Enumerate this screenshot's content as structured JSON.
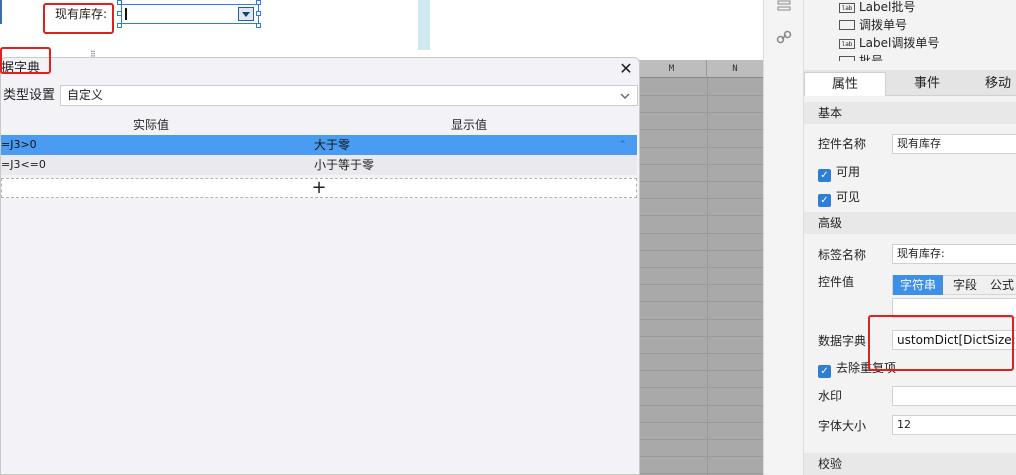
{
  "canvas": {
    "field_label": "现有库存:",
    "field_value": "",
    "handle_text": "⠿"
  },
  "sheet": {
    "col_heads": [
      "M",
      "N"
    ]
  },
  "toolstrip": {
    "icons": [
      "layers-icon",
      "link-icon"
    ]
  },
  "panel": {
    "tree": [
      {
        "badge": "lab",
        "text": "Label批号"
      },
      {
        "badge": "box",
        "text": "调拨单号"
      },
      {
        "badge": "lab",
        "text": "Label调拨单号"
      },
      {
        "badge": "box",
        "text": "批号"
      }
    ],
    "tabs": [
      "属性",
      "事件",
      "移动"
    ],
    "active_tab": "属性",
    "sections": {
      "basic": "基本",
      "advanced": "高级",
      "validate": "校验"
    },
    "control_name_label": "控件名称",
    "control_name_value": "现有库存",
    "enabled_label": "可用",
    "visible_label": "可见",
    "tag_name_label": "标签名称",
    "tag_name_value": "现有库存:",
    "control_value_label": "控件值",
    "value_types": [
      "字符串",
      "字段",
      "公式"
    ],
    "active_value_type": "字符串",
    "dict_label": "数据字典",
    "dict_value": "ustomDict[DictSize:2]",
    "dedupe_label": "去除重复项",
    "watermark_label": "水印",
    "watermark_value": "",
    "fontsize_label": "字体大小",
    "fontsize_value": "12"
  },
  "dialog": {
    "title": "据字典",
    "close_glyph": "✕",
    "type_label": "类型设置",
    "type_value": "自定义",
    "columns": [
      "实际值",
      "显示值"
    ],
    "rows": [
      {
        "actual": "=J3>0",
        "display": "大于零",
        "selected": true
      },
      {
        "actual": "=J3<=0",
        "display": "小于等于零",
        "selected": false
      }
    ],
    "add_glyph": "+"
  },
  "colors": {
    "accent": "#3d8fe8",
    "selected_row": "#4a9cf2",
    "highlight": "#e02020",
    "sheet": "#a9a9a9"
  }
}
